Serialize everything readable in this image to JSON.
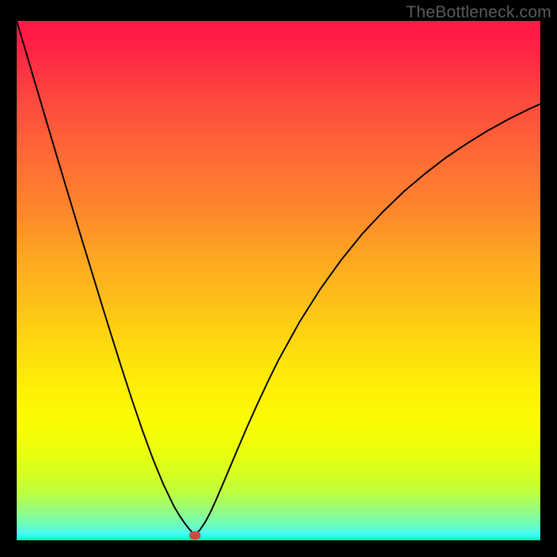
{
  "watermark": "TheBottleneck.com",
  "chart_data": {
    "type": "line",
    "title": "",
    "xlabel": "",
    "ylabel": "",
    "xlim": [
      0,
      100
    ],
    "ylim": [
      0,
      100
    ],
    "optimum_x": 34,
    "marker_color": "#cc4b40",
    "x": [
      0,
      2,
      4,
      6,
      8,
      10,
      12,
      14,
      16,
      18,
      20,
      22,
      24,
      26,
      28,
      30,
      31,
      32,
      33,
      34,
      35,
      36,
      37,
      38,
      40,
      42,
      44,
      46,
      48,
      50,
      54,
      58,
      62,
      66,
      70,
      74,
      78,
      82,
      86,
      90,
      94,
      98,
      100
    ],
    "values": [
      100,
      93.2,
      86.4,
      79.6,
      72.8,
      66.1,
      59.4,
      52.8,
      46.2,
      39.7,
      33.3,
      27.1,
      21.2,
      15.7,
      10.8,
      6.6,
      4.9,
      3.4,
      2.1,
      1.0,
      2.0,
      3.5,
      5.4,
      7.6,
      12.3,
      17.1,
      21.8,
      26.3,
      30.6,
      34.7,
      42.0,
      48.4,
      54.0,
      59.0,
      63.3,
      67.2,
      70.6,
      73.7,
      76.4,
      78.9,
      81.1,
      83.1,
      84.0
    ],
    "gradient_stops": [
      {
        "pos": 0,
        "color": "#fe1b48"
      },
      {
        "pos": 0.38,
        "color": "#fe8b2a"
      },
      {
        "pos": 0.76,
        "color": "#fcfa03"
      },
      {
        "pos": 0.95,
        "color": "#8afc92"
      },
      {
        "pos": 1.0,
        "color": "#10f58e"
      }
    ]
  }
}
